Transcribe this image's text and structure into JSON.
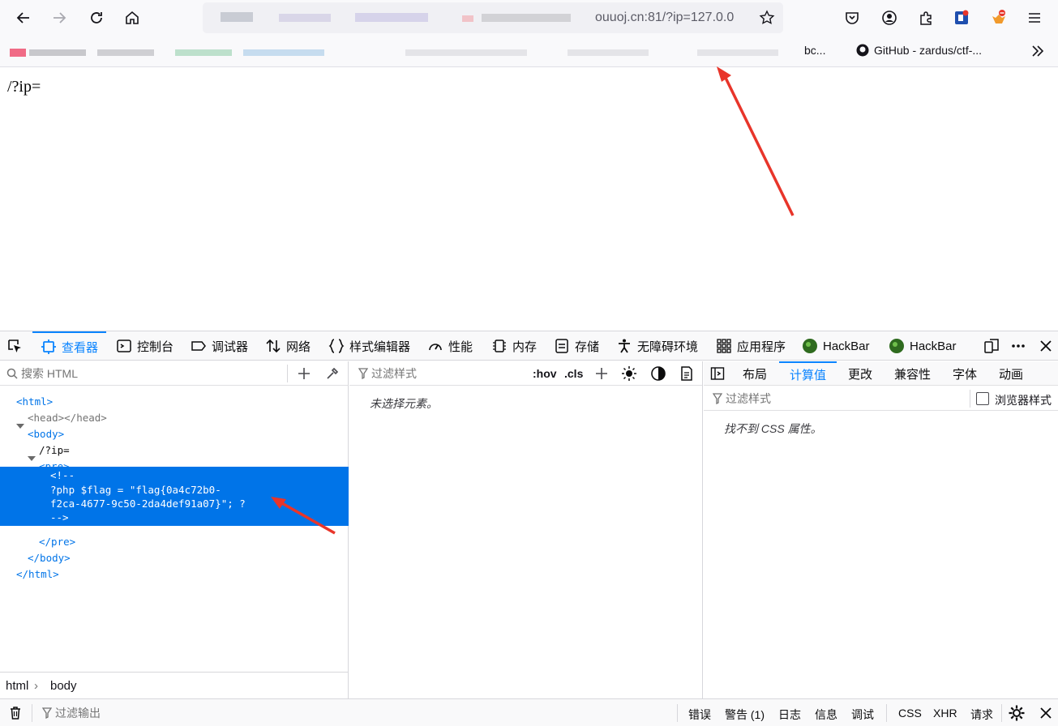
{
  "browser": {
    "url_visible": "ouuoj.cn:81/?ip=127.0.0",
    "bookmarks": [
      "GitHub - zardus/ctf-...",
      "bc..."
    ]
  },
  "page": {
    "text": "/?ip="
  },
  "devtools": {
    "tabs": [
      "查看器",
      "控制台",
      "调试器",
      "网络",
      "样式编辑器",
      "性能",
      "内存",
      "存储",
      "无障碍环境",
      "应用程序",
      "HackBar",
      "HackBar"
    ],
    "html_search_placeholder": "搜索 HTML",
    "tree": {
      "html_open": "<html>",
      "head": "<head></head>",
      "body_open": "<body>",
      "text_node": "/?ip=",
      "pre_open": "<pre>",
      "comment_lines": [
        "<!--",
        "?php $flag = \"flag{0a4c72b0-",
        "f2ca-4677-9c50-2da4def91a07}\"; ?",
        "-->"
      ],
      "pre_close": "</pre>",
      "body_close": "</body>",
      "html_close": "</html>"
    },
    "breadcrumbs": [
      "html",
      "body"
    ],
    "rules": {
      "filter_placeholder": "过滤样式",
      "hov": ":hov",
      "cls": ".cls",
      "empty": "未选择元素。"
    },
    "side": {
      "tabs": [
        "布局",
        "计算值",
        "更改",
        "兼容性",
        "字体",
        "动画"
      ],
      "filter_placeholder": "过滤样式",
      "browser_styles": "浏览器样式",
      "empty": "找不到 CSS 属性。"
    },
    "console": {
      "filter_placeholder": "过滤输出",
      "levels": [
        "错误",
        "警告 (1)",
        "日志",
        "信息",
        "调试",
        "CSS",
        "XHR",
        "请求"
      ]
    }
  },
  "colors": {
    "accent": "#0a84ff",
    "selection": "#0074e8",
    "annotation_arrow": "#e8352a"
  }
}
